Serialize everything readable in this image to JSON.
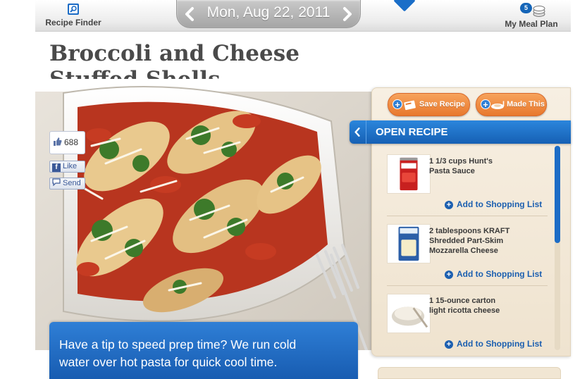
{
  "nav": {
    "recipe_finder": "Recipe Finder",
    "meal_plan": "My Meal Plan",
    "meal_plan_count": "5"
  },
  "date_nav": {
    "date": "Mon, Aug 22, 2011",
    "prev_icon": "chevron-left-icon",
    "next_icon": "chevron-right-icon"
  },
  "recipe": {
    "title_line1": "Broccoli and Cheese",
    "title_line2": "Stuffed Shells"
  },
  "social": {
    "like_count": "688",
    "like_label": "Like",
    "send_label": "Send"
  },
  "tip": {
    "line1": "Have a tip to speed prep time? We run cold",
    "line2": "water over hot pasta for quick cool time."
  },
  "panel": {
    "save_recipe": "Save Recipe",
    "made_this": "I Made This",
    "open_recipe": "OPEN RECIPE",
    "add_to_list": "Add to Shopping List"
  },
  "ingredients": [
    {
      "line1": "1 1/3 cups Hunt's",
      "line2": "Pasta Sauce",
      "line3": "",
      "image": "hunts-can"
    },
    {
      "line1": "2 tablespoons KRAFT",
      "line2": "Shredded Part-Skim",
      "line3": "Mozzarella Cheese",
      "image": "kraft-cheese-bag"
    },
    {
      "line1": "1 15-ounce carton",
      "line2": "light ricotta cheese",
      "line3": "",
      "image": "ricotta-bowl"
    }
  ],
  "colors": {
    "accent_blue": "#1c6cc6",
    "orange_button": "#e8782d",
    "panel_bg": "#f3e9d8"
  }
}
